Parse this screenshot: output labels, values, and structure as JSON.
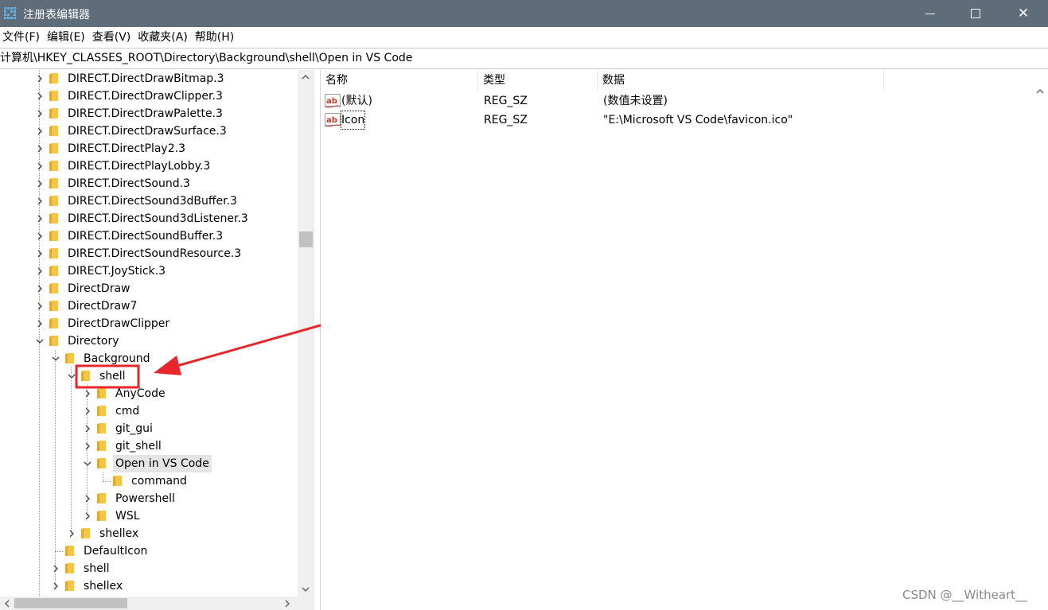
{
  "window": {
    "title": "注册表编辑器",
    "minimize_icon": "minimize-icon",
    "maximize_icon": "maximize-icon",
    "close_icon": "close-icon",
    "close_glyph": "✕"
  },
  "menu": [
    "文件(F)",
    "编辑(E)",
    "查看(V)",
    "收藏夹(A)",
    "帮助(H)"
  ],
  "address": "计算机\\HKEY_CLASSES_ROOT\\Directory\\Background\\shell\\Open in VS Code",
  "tree": [
    {
      "label": "DIRECT.DirectDrawBitmap.3",
      "level": 0,
      "expander": "collapsed"
    },
    {
      "label": "DIRECT.DirectDrawClipper.3",
      "level": 0,
      "expander": "collapsed"
    },
    {
      "label": "DIRECT.DirectDrawPalette.3",
      "level": 0,
      "expander": "collapsed"
    },
    {
      "label": "DIRECT.DirectDrawSurface.3",
      "level": 0,
      "expander": "collapsed"
    },
    {
      "label": "DIRECT.DirectPlay2.3",
      "level": 0,
      "expander": "collapsed"
    },
    {
      "label": "DIRECT.DirectPlayLobby.3",
      "level": 0,
      "expander": "collapsed"
    },
    {
      "label": "DIRECT.DirectSound.3",
      "level": 0,
      "expander": "collapsed"
    },
    {
      "label": "DIRECT.DirectSound3dBuffer.3",
      "level": 0,
      "expander": "collapsed"
    },
    {
      "label": "DIRECT.DirectSound3dListener.3",
      "level": 0,
      "expander": "collapsed"
    },
    {
      "label": "DIRECT.DirectSoundBuffer.3",
      "level": 0,
      "expander": "collapsed"
    },
    {
      "label": "DIRECT.DirectSoundResource.3",
      "level": 0,
      "expander": "collapsed"
    },
    {
      "label": "DIRECT.JoyStick.3",
      "level": 0,
      "expander": "collapsed"
    },
    {
      "label": "DirectDraw",
      "level": 0,
      "expander": "collapsed"
    },
    {
      "label": "DirectDraw7",
      "level": 0,
      "expander": "collapsed"
    },
    {
      "label": "DirectDrawClipper",
      "level": 0,
      "expander": "collapsed"
    },
    {
      "label": "Directory",
      "level": 0,
      "expander": "expanded"
    },
    {
      "label": "Background",
      "level": 1,
      "expander": "expanded"
    },
    {
      "label": "shell",
      "level": 2,
      "expander": "expanded"
    },
    {
      "label": "AnyCode",
      "level": 3,
      "expander": "collapsed"
    },
    {
      "label": "cmd",
      "level": 3,
      "expander": "collapsed"
    },
    {
      "label": "git_gui",
      "level": 3,
      "expander": "collapsed"
    },
    {
      "label": "git_shell",
      "level": 3,
      "expander": "collapsed"
    },
    {
      "label": "Open in VS Code",
      "level": 3,
      "expander": "expanded",
      "selected": true
    },
    {
      "label": "command",
      "level": 4,
      "expander": "none"
    },
    {
      "label": "Powershell",
      "level": 3,
      "expander": "collapsed"
    },
    {
      "label": "WSL",
      "level": 3,
      "expander": "collapsed"
    },
    {
      "label": "shellex",
      "level": 2,
      "expander": "collapsed"
    },
    {
      "label": "DefaultIcon",
      "level": 1,
      "expander": "none"
    },
    {
      "label": "shell",
      "level": 1,
      "expander": "collapsed"
    },
    {
      "label": "shellex",
      "level": 1,
      "expander": "collapsed"
    }
  ],
  "columns": {
    "name": "名称",
    "type": "类型",
    "data": "数据"
  },
  "values": [
    {
      "name": "(默认)",
      "type": "REG_SZ",
      "data": "(数值未设置)",
      "icon": "string-value-icon"
    },
    {
      "name": "Icon",
      "type": "REG_SZ",
      "data": "\"E:\\Microsoft VS Code\\favicon.ico\"",
      "icon": "string-value-icon",
      "focused": true
    }
  ],
  "colors": {
    "titlebar": "#5f6d7a",
    "folder": "#f3c54b",
    "annotation": "#e8262b",
    "selection": "#e5e5e5"
  },
  "watermark": "CSDN @__Witheart__"
}
